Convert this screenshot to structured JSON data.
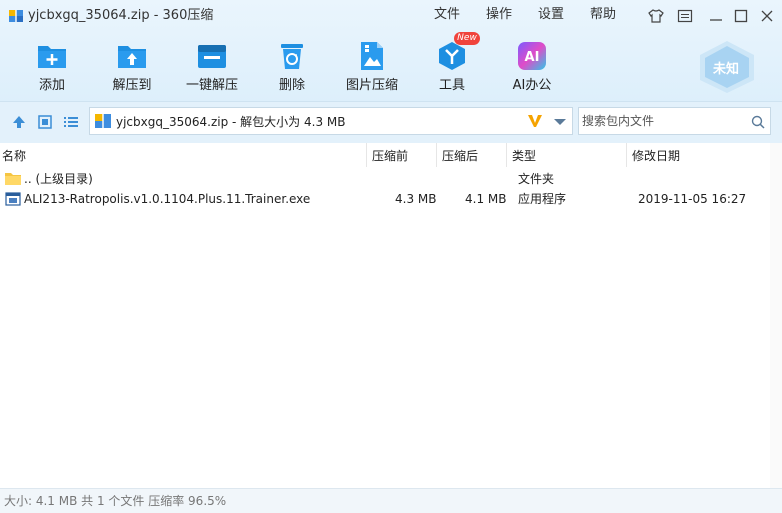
{
  "window": {
    "title": "yjcbxgq_35064.zip - 360压缩"
  },
  "menu": {
    "file": "文件",
    "operate": "操作",
    "settings": "设置",
    "help": "帮助"
  },
  "toolbar": {
    "add": "添加",
    "extract_to": "解压到",
    "one_click_extract": "一键解压",
    "delete": "删除",
    "image_compress": "图片压缩",
    "tools": "工具",
    "tools_badge": "New",
    "ai_office": "AI办公",
    "ai_icon_text": "AI"
  },
  "user": {
    "avatar_text": "未知"
  },
  "address": {
    "path": "yjcbxgq_35064.zip - 解包大小为 4.3 MB"
  },
  "search": {
    "placeholder": "搜索包内文件"
  },
  "columns": {
    "name": "名称",
    "packed": "压缩前",
    "unpacked": "压缩后",
    "type": "类型",
    "modified": "修改日期"
  },
  "rows": [
    {
      "name": ".. (上级目录)",
      "packed": "",
      "unpacked": "",
      "type": "文件夹",
      "modified": ""
    },
    {
      "name": "ALI213-Ratropolis.v1.0.1104.Plus.11.Trainer.exe",
      "packed": "4.3 MB",
      "unpacked": "4.1 MB",
      "type": "应用程序",
      "modified": "2019-11-05 16:27"
    }
  ],
  "status": {
    "text": "大小: 4.1 MB 共 1 个文件 压缩率 96.5%"
  },
  "colors": {
    "accent": "#1e8fe1",
    "badge": "#f0433c",
    "toolbar_bg": "#e3f1fb"
  }
}
